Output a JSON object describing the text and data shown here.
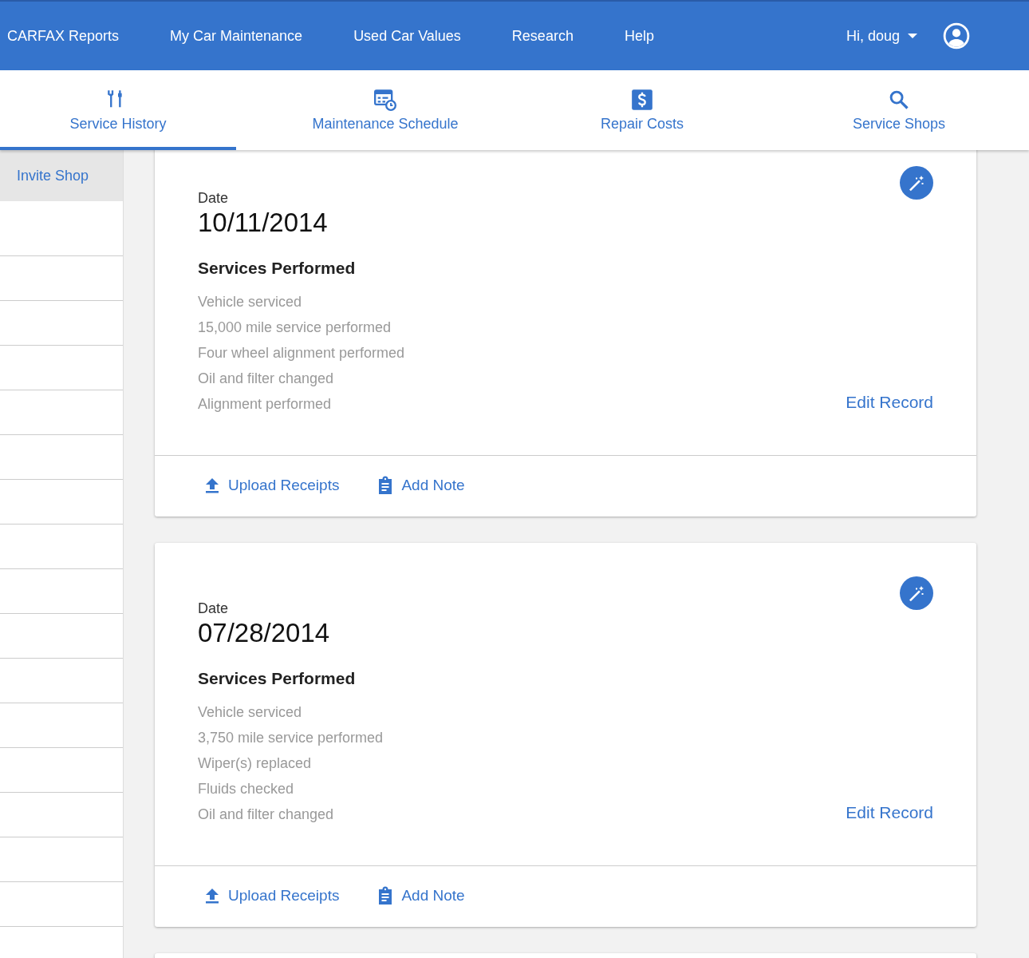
{
  "top_nav": {
    "links": [
      "CARFAX Reports",
      "My Car Maintenance",
      "Used Car Values",
      "Research",
      "Help"
    ],
    "user": {
      "greeting": "Hi, doug"
    }
  },
  "tabs": [
    {
      "label": "Service History",
      "kind": "tools",
      "selected": true
    },
    {
      "label": "Maintenance Schedule",
      "kind": "schedule",
      "selected": false
    },
    {
      "label": "Repair Costs",
      "kind": "dollar",
      "selected": false
    },
    {
      "label": "Service Shops",
      "kind": "search",
      "selected": false
    }
  ],
  "sidebar": {
    "items": [
      {
        "label": "Invite Shop",
        "selected": true
      }
    ]
  },
  "records": [
    {
      "date_label": "Date",
      "date": "10/11/2014",
      "services_title": "Services Performed",
      "services": [
        "Vehicle serviced",
        "15,000 mile service performed",
        "Four wheel alignment performed",
        "Oil and filter changed",
        "Alignment performed"
      ],
      "edit_label": "Edit Record",
      "actions": [
        {
          "kind": "upload",
          "label": "Upload Receipts"
        },
        {
          "kind": "note",
          "label": "Add Note"
        }
      ]
    },
    {
      "date_label": "Date",
      "date": "07/28/2014",
      "services_title": "Services Performed",
      "services": [
        "Vehicle serviced",
        "3,750 mile service performed",
        "Wiper(s) replaced",
        "Fluids checked",
        "Oil and filter changed"
      ],
      "edit_label": "Edit Record",
      "actions": [
        {
          "kind": "upload",
          "label": "Upload Receipts"
        },
        {
          "kind": "note",
          "label": "Add Note"
        }
      ]
    }
  ]
}
